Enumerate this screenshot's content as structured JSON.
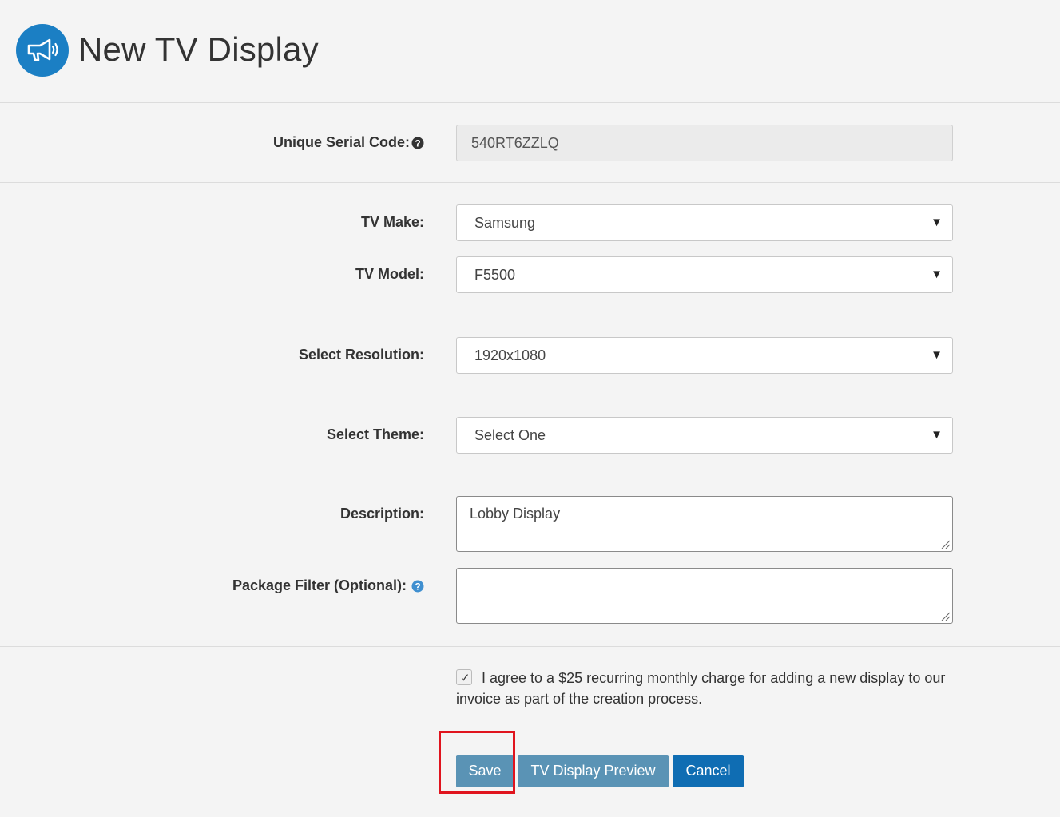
{
  "header": {
    "title": "New TV Display",
    "icon": "megaphone-icon",
    "icon_bg": "#1b7fc4"
  },
  "serial": {
    "label": "Unique Serial Code:",
    "value": "540RT6ZZLQ"
  },
  "tv_make": {
    "label": "TV Make:",
    "value": "Samsung"
  },
  "tv_model": {
    "label": "TV Model:",
    "value": "F5500"
  },
  "resolution": {
    "label": "Select Resolution:",
    "value": "1920x1080"
  },
  "theme": {
    "label": "Select Theme:",
    "value": "Select One"
  },
  "description": {
    "label": "Description:",
    "value": "Lobby Display"
  },
  "package_filter": {
    "label": "Package Filter (Optional):",
    "value": ""
  },
  "agreement": {
    "checked": true,
    "text": "I agree to a $25 recurring monthly charge for adding a new display to our invoice as part of the creation process."
  },
  "buttons": {
    "save": "Save",
    "preview": "TV Display Preview",
    "cancel": "Cancel"
  },
  "colors": {
    "primary": "#0f6db3",
    "secondary_button": "#5a93b5",
    "highlight": "#e0141e"
  }
}
